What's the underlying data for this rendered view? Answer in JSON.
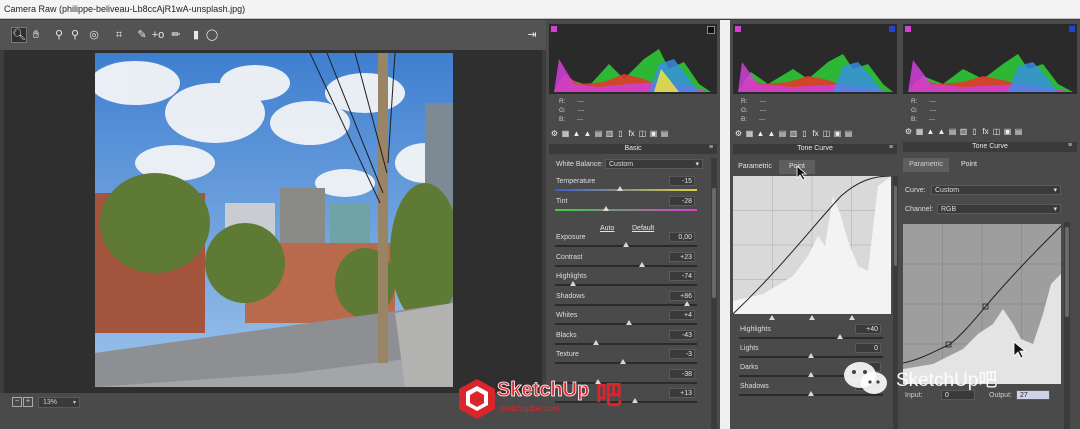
{
  "window": {
    "title": "Camera Raw (philippe-beliveau-Lb8ccAjR1wA-unsplash.jpg)"
  },
  "toolbar": {
    "tools": [
      {
        "name": "zoom-tool",
        "glyph": "🔍︎"
      },
      {
        "name": "hand-tool",
        "glyph": "✋︎"
      },
      {
        "name": "white-balance-tool",
        "glyph": "⚲"
      },
      {
        "name": "color-sampler-tool",
        "glyph": "⚲"
      },
      {
        "name": "targeted-adjustment-tool",
        "glyph": "◎"
      },
      {
        "name": "crop-tool",
        "glyph": "⌗"
      },
      {
        "name": "spot-removal-tool",
        "glyph": "✎"
      },
      {
        "name": "red-eye-tool",
        "glyph": "+o"
      },
      {
        "name": "adjustment-brush-tool",
        "glyph": "✏"
      },
      {
        "name": "graduated-filter-tool",
        "glyph": "▮"
      },
      {
        "name": "radial-filter-tool",
        "glyph": "◯"
      }
    ],
    "export_icon": "⇥"
  },
  "status": {
    "zoom": "13%"
  },
  "panel1": {
    "rgb": [
      "R:",
      "G:",
      "B:"
    ],
    "rgb_values": [
      "---",
      "---",
      "---"
    ],
    "header": "Basic",
    "white_balance_label": "White Balance:",
    "white_balance_value": "Custom",
    "auto": "Auto",
    "default": "Default",
    "sliders": [
      {
        "label": "Temperature",
        "value": "-15",
        "level": 0.46
      },
      {
        "label": "Tint",
        "value": "-28",
        "level": 0.36
      },
      {
        "label": "Exposure",
        "value": "0,00",
        "level": 0.5
      },
      {
        "label": "Contrast",
        "value": "+23",
        "level": 0.61
      },
      {
        "label": "Highlights",
        "value": "-74",
        "level": 0.13
      },
      {
        "label": "Shadows",
        "value": "+86",
        "level": 0.93
      },
      {
        "label": "Whites",
        "value": "+4",
        "level": 0.52
      },
      {
        "label": "Blacks",
        "value": "-43",
        "level": 0.29
      },
      {
        "label": "Texture",
        "value": "-3",
        "level": 0.48
      },
      {
        "label": "",
        "value": "-38",
        "level": 0.3
      },
      {
        "label": "",
        "value": "+13",
        "level": 0.56
      }
    ]
  },
  "panel2": {
    "rgb": [
      "R:",
      "G:",
      "B:"
    ],
    "rgb_values": [
      "---",
      "---",
      "---"
    ],
    "header": "Tone Curve",
    "tabs": [
      "Parametric",
      "Point"
    ],
    "sliders": [
      {
        "label": "Highlights",
        "value": "+40",
        "level": 0.7
      },
      {
        "label": "Lights",
        "value": "0",
        "level": 0.5
      },
      {
        "label": "Darks",
        "value": "",
        "level": 0.5
      },
      {
        "label": "Shadows",
        "value": "",
        "level": 0.5
      }
    ]
  },
  "panel3": {
    "rgb": [
      "R:",
      "G:",
      "B:"
    ],
    "rgb_values": [
      "---",
      "---",
      "---"
    ],
    "header": "Tone Curve",
    "tabs": [
      "Parametric",
      "Point"
    ],
    "curve_label": "Curve:",
    "curve_value": "Custom",
    "channel_label": "Channel:",
    "channel_value": "RGB",
    "input_label": "Input:",
    "input_value": "0",
    "output_label": "Output:",
    "output_value": "27"
  },
  "watermark": {
    "logo_text": "SketchUp",
    "logo_sub": "sketchupbar.com",
    "logo_tail": "吧",
    "wechat_text": "SketchUp吧"
  },
  "colors": {
    "panel": "#4a4a4a",
    "histogram_bg": "#2a2a2a",
    "accent_logo": "#d9262d"
  }
}
